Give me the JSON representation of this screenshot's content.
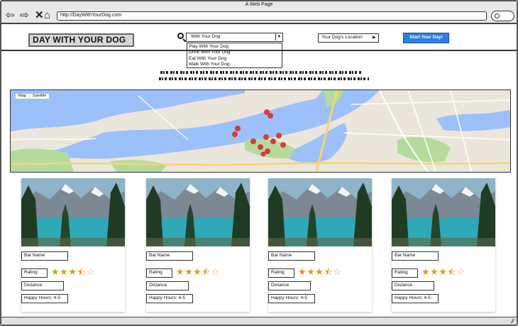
{
  "window": {
    "title": "A Web Page"
  },
  "browser": {
    "url": "http://DayWithYourDog.com",
    "back_icon": "back-arrow-icon",
    "forward_icon": "forward-arrow-icon",
    "close_icon": "close-icon",
    "home_icon": "home-icon"
  },
  "header": {
    "logo": "DAY WITH YOUR DOG",
    "search_value": "With Your Dog",
    "search_options": [
      "Play With Your Dog",
      "Drink With Your Dog",
      "Eat With Your Dog",
      "Walk With Your Dog"
    ],
    "location_placeholder": "Your Dog's Location",
    "start_button": "Start Your Day!"
  },
  "map": {
    "toggle": [
      "Map",
      "Satellite"
    ],
    "accent_water": "#9cc0f9",
    "accent_park": "#b3dc9c",
    "pin_color": "#d93a3a"
  },
  "cards": [
    {
      "bar_name": "Bar Name",
      "rating_label": "Rating",
      "rating": 3.5,
      "distance_label": "Distance",
      "happy_hours": "Happy Hours: 4-5"
    },
    {
      "bar_name": "Bar Name",
      "rating_label": "Rating",
      "rating": 3.5,
      "distance_label": "Distance",
      "happy_hours": "Happy Hours: 4-5"
    },
    {
      "bar_name": "Bar Name",
      "rating_label": "Rating",
      "rating": 3.5,
      "distance_label": "Distance",
      "happy_hours": "Happy Hours: 4-5"
    },
    {
      "bar_name": "Bar Name",
      "rating_label": "Rating",
      "rating": 3.5,
      "distance_label": "Distance",
      "happy_hours": "Happy Hours: 4-5"
    }
  ]
}
